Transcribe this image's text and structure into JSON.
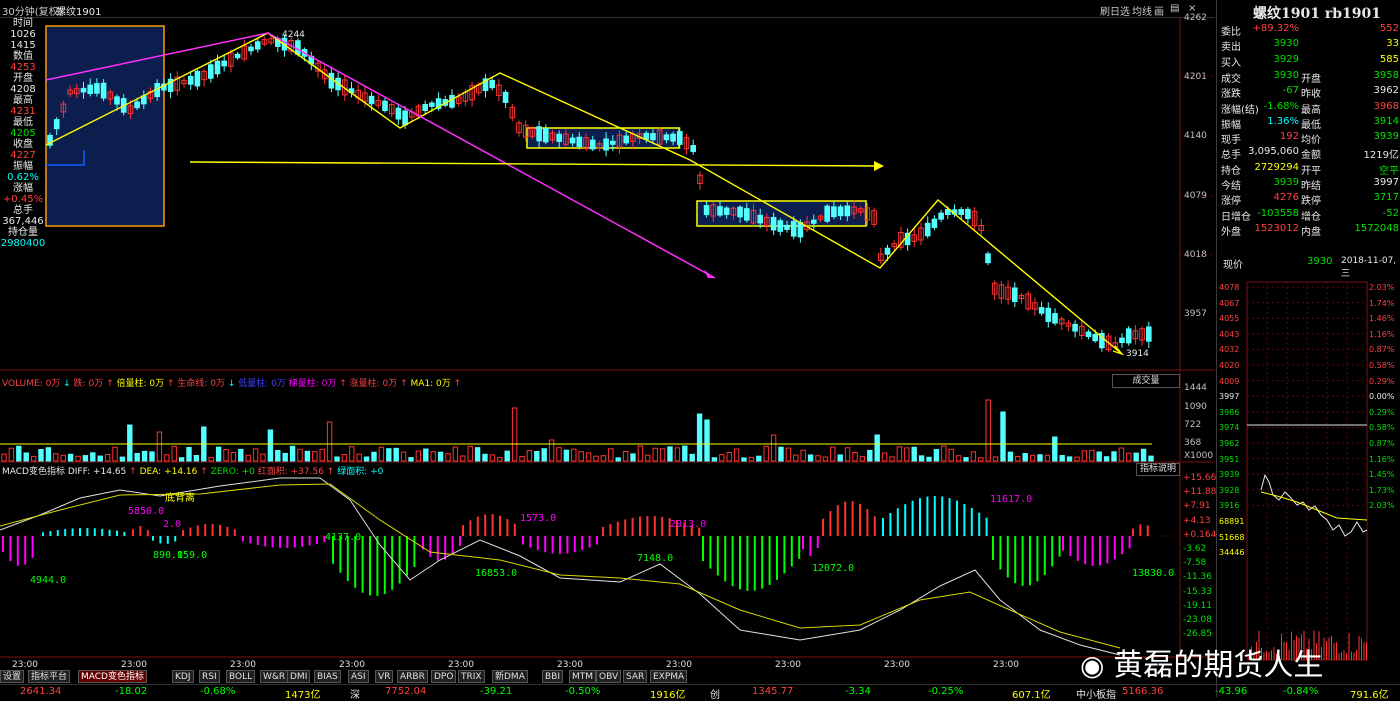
{
  "title_bar": {
    "period": "30分钟(复权)",
    "symbol": "螺纹1901",
    "tools": [
      "刷",
      "日",
      "选",
      "均",
      "线",
      "画"
    ],
    "btn_print": "▤",
    "btn_close": "×"
  },
  "left_panel": [
    {
      "t": "时间",
      "c": "#e8e8e8"
    },
    {
      "t": "1026",
      "c": "#e8e8e8"
    },
    {
      "t": "1415",
      "c": "#e8e8e8"
    },
    {
      "t": "数值",
      "c": "#e8e8e8"
    },
    {
      "t": "4253",
      "c": "#ff4040"
    },
    {
      "t": "开盘",
      "c": "#e8e8e8"
    },
    {
      "t": "4208",
      "c": "#e8e8e8"
    },
    {
      "t": "最高",
      "c": "#e8e8e8"
    },
    {
      "t": "4231",
      "c": "#ff4040"
    },
    {
      "t": "最低",
      "c": "#e8e8e8"
    },
    {
      "t": "4205",
      "c": "#00e000"
    },
    {
      "t": "收盘",
      "c": "#e8e8e8"
    },
    {
      "t": "4227",
      "c": "#ff4040"
    },
    {
      "t": "振幅",
      "c": "#e8e8e8"
    },
    {
      "t": "0.62%",
      "c": "#00ffff"
    },
    {
      "t": "涨幅",
      "c": "#e8e8e8"
    },
    {
      "t": "+0.45%",
      "c": "#ff4040"
    },
    {
      "t": "总手",
      "c": "#e8e8e8"
    },
    {
      "t": "367,446",
      "c": "#e8e8e8"
    },
    {
      "t": "持仓量",
      "c": "#e8e8e8"
    },
    {
      "t": "2980400",
      "c": "#00ffff"
    }
  ],
  "price_axis": [
    "4262",
    "4201",
    "4140",
    "4079",
    "4018",
    "3957"
  ],
  "price_labels": {
    "high": "4244",
    "low": "3914"
  },
  "volume": {
    "header": [
      {
        "t": "VOLUME: 0万",
        "c": "#ff4040"
      },
      {
        "t": "↓",
        "c": "#00ffff"
      },
      {
        "t": "跌: 0万",
        "c": "#ff4040"
      },
      {
        "t": "↑",
        "c": "#ff4040"
      },
      {
        "t": "倍量柱: 0万",
        "c": "#ffff00"
      },
      {
        "t": "↑",
        "c": "#ff4040"
      },
      {
        "t": "生命线: 0万",
        "c": "#ff4040"
      },
      {
        "t": "↓",
        "c": "#00ffff"
      },
      {
        "t": "低量柱: 0万",
        "c": "#4040ff"
      },
      {
        "t": "梯量柱: 0万",
        "c": "#ff00ff"
      },
      {
        "t": "↑",
        "c": "#ff4040"
      },
      {
        "t": "涨量柱: 0万",
        "c": "#ff4040"
      },
      {
        "t": "↑",
        "c": "#ff4040"
      },
      {
        "t": "MA1: 0万",
        "c": "#ffff00"
      },
      {
        "t": "↑",
        "c": "#ff4040"
      }
    ],
    "btn": "成交量",
    "axis": [
      "1444",
      "1090",
      "722",
      "368"
    ],
    "unit": "X1000"
  },
  "macd": {
    "header": [
      {
        "t": "MACD变色指标",
        "c": "#e8e8e8"
      },
      {
        "t": "DIFF: +14.65",
        "c": "#e8e8e8"
      },
      {
        "t": "↑",
        "c": "#ff4040"
      },
      {
        "t": "DEA: +14.16",
        "c": "#ffff00"
      },
      {
        "t": "↑",
        "c": "#ff4040"
      },
      {
        "t": "ZERO: +0",
        "c": "#00e000"
      },
      {
        "t": "红面积: +37.56",
        "c": "#ff4040"
      },
      {
        "t": "↑",
        "c": "#ff4040"
      },
      {
        "t": "绿面积: +0",
        "c": "#00ffff"
      }
    ],
    "btn": "指标说明",
    "axis": [
      "+15.66",
      "+11.88",
      "+7.91",
      "+4.13",
      "+0.164",
      "-3.62",
      "-7.58",
      "-11.36",
      "-15.33",
      "-19.11",
      "-23.08",
      "-26.85"
    ],
    "labels": [
      {
        "t": "5850.0",
        "c": "#ff00ff"
      },
      {
        "t": "2.0",
        "c": "#ff00ff"
      },
      {
        "t": "4944.0",
        "c": "#00ff00"
      },
      {
        "t": "890.0",
        "c": "#00ff00"
      },
      {
        "t": "159.0",
        "c": "#00ff00"
      },
      {
        "t": "4137.0",
        "c": "#00ff00"
      },
      {
        "t": "1573.0",
        "c": "#ff00ff"
      },
      {
        "t": "16853.0",
        "c": "#00ff00"
      },
      {
        "t": "7148.0",
        "c": "#00ff00"
      },
      {
        "t": "2013.0",
        "c": "#ff00ff"
      },
      {
        "t": "12072.0",
        "c": "#00ff00"
      },
      {
        "t": "11617.0",
        "c": "#ff00ff"
      },
      {
        "t": "13830.0",
        "c": "#00ff00"
      }
    ],
    "cross_label": "底背离"
  },
  "time_axis": [
    "23:00",
    "23:00",
    "23:00",
    "23:00",
    "23:00",
    "23:00",
    "23:00",
    "23:00",
    "23:00",
    "23:00"
  ],
  "tabs": [
    "设置",
    "指标平台",
    "MACD变色指标",
    "KDJ",
    "RSI",
    "BOLL",
    "W&R",
    "DMI",
    "BIAS",
    "ASI",
    "VR",
    "ARBR",
    "DPO",
    "TRIX",
    "新DMA",
    "BBI",
    "MTM",
    "OBV",
    "SAR",
    "EXPMA"
  ],
  "status": [
    {
      "t": "2641.34",
      "c": "#ff4040"
    },
    {
      "t": "-18.02",
      "c": "#00ff00"
    },
    {
      "t": "-0.68%",
      "c": "#00ff00"
    },
    {
      "t": "1473亿",
      "c": "#ffff00"
    },
    {
      "t": "深",
      "c": "#e8e8e8"
    },
    {
      "t": "7752.04",
      "c": "#ff4040"
    },
    {
      "t": "-39.21",
      "c": "#00ff00"
    },
    {
      "t": "-0.50%",
      "c": "#00ff00"
    },
    {
      "t": "1916亿",
      "c": "#ffff00"
    },
    {
      "t": "创",
      "c": "#e8e8e8"
    },
    {
      "t": "1345.77",
      "c": "#ff4040"
    },
    {
      "t": "-3.34",
      "c": "#00ff00"
    },
    {
      "t": "-0.25%",
      "c": "#00ff00"
    },
    {
      "t": "607.1亿",
      "c": "#ffff00"
    },
    {
      "t": "中小板指",
      "c": "#e8e8e8"
    },
    {
      "t": "5166.36",
      "c": "#ff4040"
    },
    {
      "t": "-43.96",
      "c": "#00ff00"
    },
    {
      "t": "-0.84%",
      "c": "#00ff00"
    },
    {
      "t": "791.6亿",
      "c": "#ffff00"
    }
  ],
  "right_panel": {
    "title": "螺纹1901 rb1901",
    "rows": [
      {
        "l": "委比",
        "v": "+89.32%",
        "vc": "#ff4040",
        "l2": "",
        "v2": "552",
        "v2c": "#ff4040"
      },
      {
        "l": "卖出",
        "v": "3930",
        "vc": "#00e000",
        "l2": "",
        "v2": "33",
        "v2c": "#ffff00"
      },
      {
        "l": "买入",
        "v": "3929",
        "vc": "#00e000",
        "l2": "",
        "v2": "585",
        "v2c": "#ffff00"
      },
      {
        "l": "成交",
        "v": "3930",
        "vc": "#00e000",
        "l2": "开盘",
        "v2": "3958",
        "v2c": "#00e000"
      },
      {
        "l": "涨跌",
        "v": "-67",
        "vc": "#00e000",
        "l2": "昨收",
        "v2": "3962",
        "v2c": "#e8e8e8"
      },
      {
        "l": "涨幅(结)",
        "v": "-1.68%",
        "vc": "#00e000",
        "l2": "最高",
        "v2": "3968",
        "v2c": "#ff4040"
      },
      {
        "l": "振幅",
        "v": "1.36%",
        "vc": "#00ffff",
        "l2": "最低",
        "v2": "3914",
        "v2c": "#00e000"
      },
      {
        "l": "现手",
        "v": "192",
        "vc": "#ff4040",
        "l2": "均价",
        "v2": "3939",
        "v2c": "#00e000"
      },
      {
        "l": "总手",
        "v": "3,095,060",
        "vc": "#e8e8e8",
        "l2": "金额",
        "v2": "1219亿",
        "v2c": "#e8e8e8"
      },
      {
        "l": "持仓",
        "v": "2729294",
        "vc": "#ffff00",
        "l2": "开平",
        "v2": "空平",
        "v2c": "#00e000"
      },
      {
        "l": "今结",
        "v": "3939",
        "vc": "#00e000",
        "l2": "昨结",
        "v2": "3997",
        "v2c": "#e8e8e8"
      },
      {
        "l": "涨停",
        "v": "4276",
        "vc": "#ff4040",
        "l2": "跌停",
        "v2": "3717",
        "v2c": "#00e000"
      },
      {
        "l": "日增仓",
        "v": "-103558",
        "vc": "#00e000",
        "l2": "增仓",
        "v2": "-52",
        "v2c": "#00e000"
      },
      {
        "l": "外盘",
        "v": "1523012",
        "vc": "#ff4040",
        "l2": "内盘",
        "v2": "1572048",
        "v2c": "#00e000"
      }
    ],
    "now_label": "现价",
    "now_price": "3930",
    "date": "2018-11-07,三",
    "mini_axis_left": [
      "4078",
      "4067",
      "4055",
      "4043",
      "4032",
      "4020",
      "4009",
      "3997",
      "3986",
      "3974",
      "3962",
      "3951",
      "3939",
      "3928",
      "3916",
      "68891",
      "51668",
      "34446"
    ],
    "mini_axis_right": [
      "2.03%",
      "1.74%",
      "1.46%",
      "1.16%",
      "0.87%",
      "0.58%",
      "0.29%",
      "0.00%",
      "0.29%",
      "0.58%",
      "0.87%",
      "1.16%",
      "1.45%",
      "1.73%",
      "2.03%"
    ]
  },
  "watermark": "黄磊的期货人生",
  "colors": {
    "up": "#ff3232",
    "down": "#54ffff",
    "ma": "#ffff00"
  }
}
